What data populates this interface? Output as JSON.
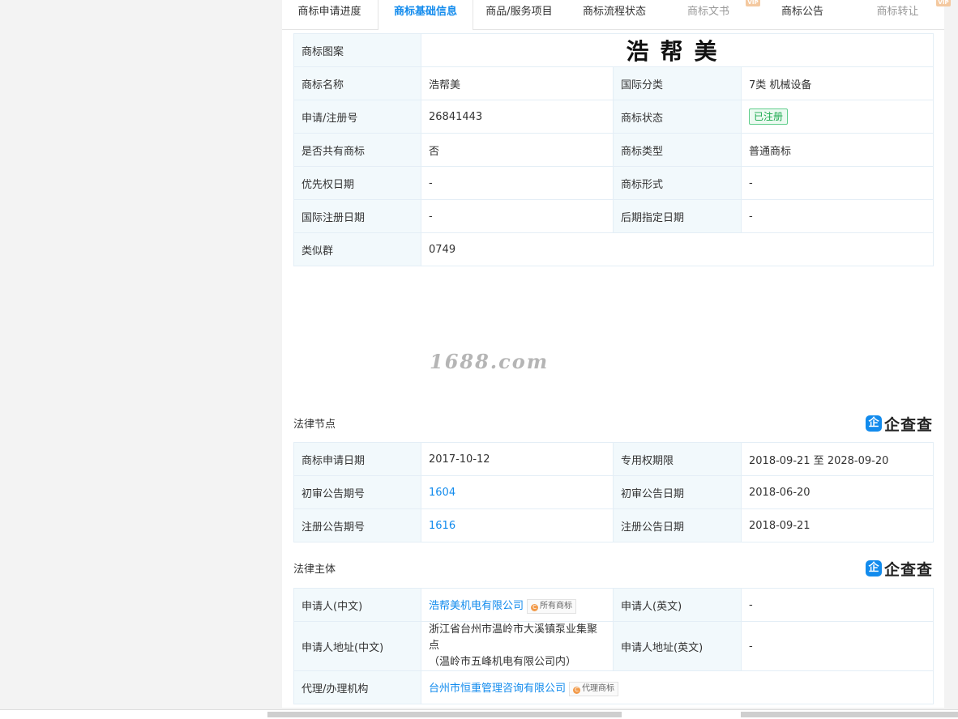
{
  "tabs": [
    {
      "label": "商标申请进度"
    },
    {
      "label": "商标基础信息"
    },
    {
      "label": "商品/服务项目"
    },
    {
      "label": "商标流程状态"
    },
    {
      "label": "商标文书",
      "badge": "VIP"
    },
    {
      "label": "商标公告"
    },
    {
      "label": "商标转让",
      "badge": "VIP"
    }
  ],
  "basic": {
    "logo_label": "商标图案",
    "logo_text": "浩帮美",
    "rows": [
      [
        "商标名称",
        "浩帮美",
        "国际分类",
        "7类 机械设备"
      ],
      [
        "申请/注册号",
        "26841443",
        "商标状态",
        "已注册"
      ],
      [
        "是否共有商标",
        "否",
        "商标类型",
        "普通商标"
      ],
      [
        "优先权日期",
        "-",
        "商标形式",
        "-"
      ],
      [
        "国际注册日期",
        "-",
        "后期指定日期",
        "-"
      ]
    ],
    "similar_label": "类似群",
    "similar_value": "0749"
  },
  "watermark": "1688.com",
  "legal_nodes": {
    "title": "法律节点",
    "rows": [
      [
        "商标申请日期",
        "2017-10-12",
        "专用权期限",
        "2018-09-21 至 2028-09-20"
      ],
      [
        "初审公告期号",
        "1604",
        "初审公告日期",
        "2018-06-20"
      ],
      [
        "注册公告期号",
        "1616",
        "注册公告日期",
        "2018-09-21"
      ]
    ]
  },
  "brand": {
    "icon": "企",
    "text": "企查查"
  },
  "legal_subject": {
    "title": "法律主体",
    "applicant_cn_label": "申请人(中文)",
    "applicant_cn": "浩帮美机电有限公司",
    "applicant_tag": "所有商标",
    "applicant_en_label": "申请人(英文)",
    "applicant_en": "-",
    "address_cn_label": "申请人地址(中文)",
    "address_cn_line1": "浙江省台州市温岭市大溪镇泵业集聚点",
    "address_cn_line2": "（温岭市五峰机电有限公司内）",
    "address_en_label": "申请人地址(英文)",
    "address_en": "-",
    "agent_label": "代理/办理机构",
    "agent": "台州市恒重管理咨询有限公司",
    "agent_tag": "代理商标"
  },
  "colors": {
    "accent": "#128bed",
    "label_bg": "#f2f9fc",
    "status_green": "#19a84c"
  }
}
